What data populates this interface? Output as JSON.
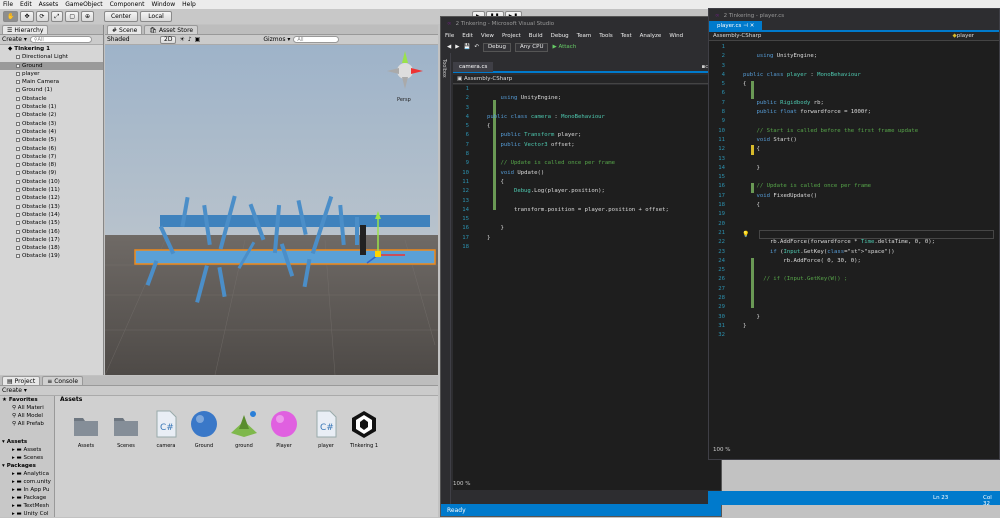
{
  "unity": {
    "menu": [
      "File",
      "Edit",
      "Assets",
      "GameObject",
      "Component",
      "Window",
      "Help"
    ],
    "toolbar": {
      "center": "Center",
      "local": "Local",
      "play": "▶",
      "pause": "❚❚",
      "step": "▶❚"
    },
    "hierarchy": {
      "tab": "Hierarchy",
      "create": "Create ▾",
      "search_placeholder": "All",
      "root": "TInkering 1",
      "items": [
        "Directional Light",
        "Ground",
        "player",
        "Main Camera",
        "Ground (1)",
        "Obstacle",
        "Obstacle (1)",
        "Obstacle (2)",
        "Obstacle (3)",
        "Obstacle (4)",
        "Obstacle (5)",
        "Obstacle (6)",
        "Obstacle (7)",
        "Obstacle (8)",
        "Obstacle (9)",
        "Obstacle (10)",
        "Obstacle (11)",
        "Obstacle (12)",
        "Obstacle (13)",
        "Obstacle (14)",
        "Obstacle (15)",
        "Obstacle (16)",
        "Obstacle (17)",
        "Obstacle (18)",
        "Obstacle (19)"
      ],
      "selected_index": 1
    },
    "scene": {
      "tab": "Scene",
      "tab2": "Asset Store",
      "shaded": "Shaded",
      "mode2d": "2D",
      "gizmos": "Gizmos ▾",
      "search_placeholder": "All",
      "persp": "Persp"
    },
    "project": {
      "tab": "Project",
      "tab2": "Console",
      "create": "Create ▾",
      "favorites": "Favorites",
      "fav_items": [
        "All Materi",
        "All Model",
        "All Prefab"
      ],
      "assets_root": "Assets",
      "asset_tree": [
        "Assets",
        "Scenes"
      ],
      "packages": "Packages",
      "package_items": [
        "Analytica",
        "com.unity",
        "In App Pu",
        "Package",
        "TextMesh",
        "Unity Col"
      ],
      "breadcrumb": "Assets",
      "assets": [
        {
          "name": "Assets",
          "icon": "folder-icon"
        },
        {
          "name": "Scenes",
          "icon": "folder-icon"
        },
        {
          "name": "camera",
          "icon": "csharp-script-icon"
        },
        {
          "name": "Ground",
          "icon": "material-sphere-icon",
          "color": "#3a78c8"
        },
        {
          "name": "ground",
          "icon": "terrain-icon"
        },
        {
          "name": "Player",
          "icon": "material-sphere-icon",
          "color": "#e060e0"
        },
        {
          "name": "player",
          "icon": "csharp-script-icon"
        },
        {
          "name": "TInkering 1",
          "icon": "unity-scene-icon"
        }
      ]
    }
  },
  "vs1": {
    "title": "2 Tinkering - Microsoft Visual Studio",
    "menu": [
      "File",
      "Edit",
      "View",
      "Project",
      "Build",
      "Debug",
      "Team",
      "Tools",
      "Test",
      "Analyze",
      "Wind"
    ],
    "config": "Debug",
    "platform": "Any CPU",
    "attach": "▶ Attach",
    "doc_tab": "camera.cs",
    "doc_tab2": "cam",
    "nav": "Assembly-CSharp",
    "zoom": "100 %",
    "status": "Ready",
    "lines": [
      {
        "n": "1",
        "t": ""
      },
      {
        "n": "2",
        "t": "    using UnityEngine;"
      },
      {
        "n": "3",
        "t": ""
      },
      {
        "n": "4",
        "t": "public class camera : MonoBehaviour"
      },
      {
        "n": "5",
        "t": "{"
      },
      {
        "n": "6",
        "t": "    public Transform player;"
      },
      {
        "n": "7",
        "t": "    public Vector3 offset;"
      },
      {
        "n": "8",
        "t": ""
      },
      {
        "n": "9",
        "t": "    // Update is called once per frame"
      },
      {
        "n": "10",
        "t": "    void Update()"
      },
      {
        "n": "11",
        "t": "    {"
      },
      {
        "n": "12",
        "t": "        Debug.Log(player.position);"
      },
      {
        "n": "13",
        "t": ""
      },
      {
        "n": "14",
        "t": "        transform.position = player.position + offset;"
      },
      {
        "n": "15",
        "t": ""
      },
      {
        "n": "16",
        "t": "    }"
      },
      {
        "n": "17",
        "t": "}"
      },
      {
        "n": "18",
        "t": ""
      }
    ]
  },
  "vs2": {
    "title": "2 Tinkering - player.cs",
    "doc_tab": "player.cs",
    "nav": "Assembly-CSharp",
    "nav2": "player",
    "zoom": "100 %",
    "ln": "Ln 23",
    "col": "Col 32",
    "lines": [
      {
        "n": "1",
        "t": ""
      },
      {
        "n": "2",
        "t": "    using UnityEngine;"
      },
      {
        "n": "3",
        "t": ""
      },
      {
        "n": "4",
        "t": "public class player : MonoBehaviour"
      },
      {
        "n": "5",
        "t": "{"
      },
      {
        "n": "6",
        "t": ""
      },
      {
        "n": "7",
        "t": "    public Rigidbody rb;"
      },
      {
        "n": "8",
        "t": "    public float forwardforce = 1000f;"
      },
      {
        "n": "9",
        "t": ""
      },
      {
        "n": "10",
        "t": "    // Start is called before the first frame update"
      },
      {
        "n": "11",
        "t": "    void Start()"
      },
      {
        "n": "12",
        "t": "    {"
      },
      {
        "n": "13",
        "t": ""
      },
      {
        "n": "14",
        "t": "    }"
      },
      {
        "n": "15",
        "t": ""
      },
      {
        "n": "16",
        "t": "    // Update is called once per frame"
      },
      {
        "n": "17",
        "t": "    void FixedUpdate()"
      },
      {
        "n": "18",
        "t": "    {"
      },
      {
        "n": "19",
        "t": ""
      },
      {
        "n": "20",
        "t": ""
      },
      {
        "n": "21",
        "t": ""
      },
      {
        "n": "22",
        "t": "        rb.AddForce(forwardforce * Time.deltaTime, 0, 0);"
      },
      {
        "n": "23",
        "t": "        if (Input.GetKey(\"space\"))"
      },
      {
        "n": "24",
        "t": "            rb.AddForce( 0, 30, 0);"
      },
      {
        "n": "25",
        "t": ""
      },
      {
        "n": "26",
        "t": "      // if (Input.GetKey(W)) ;"
      },
      {
        "n": "27",
        "t": ""
      },
      {
        "n": "28",
        "t": ""
      },
      {
        "n": "29",
        "t": ""
      },
      {
        "n": "30",
        "t": "    }"
      },
      {
        "n": "31",
        "t": "}"
      },
      {
        "n": "32",
        "t": ""
      }
    ]
  }
}
